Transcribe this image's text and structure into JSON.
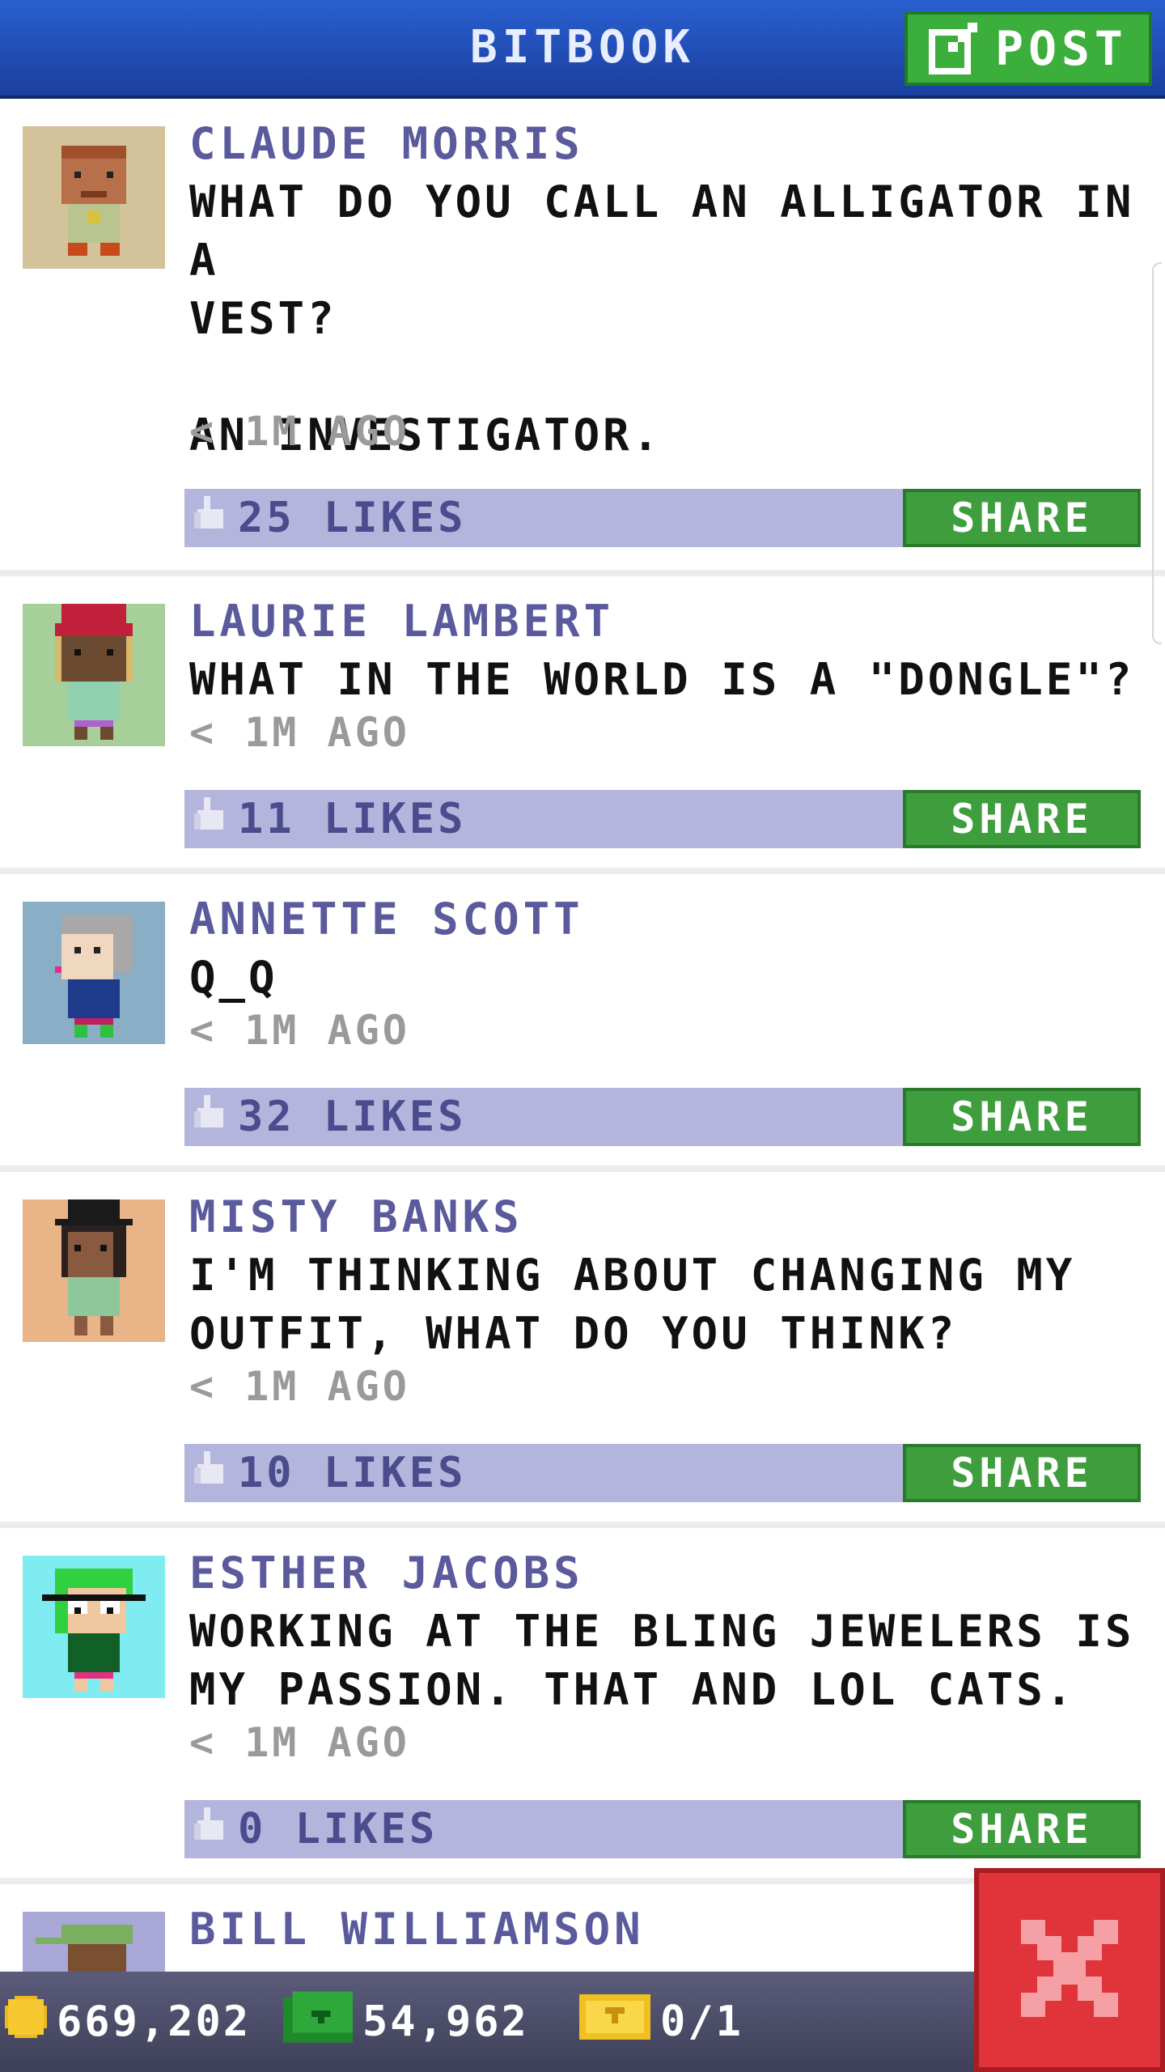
{
  "header": {
    "title": "BITBOOK",
    "post_label": "POST"
  },
  "posts": [
    {
      "name": "CLAUDE MORRIS",
      "message": "WHAT DO YOU CALL AN ALLIGATOR IN A\nVEST?\n\nAN INVESTIGATOR.",
      "time": "< 1M AGO",
      "likes": "25 LIKES",
      "share_label": "SHARE",
      "avatar_bg": "#d4c29a"
    },
    {
      "name": "LAURIE LAMBERT",
      "message": "WHAT IN THE WORLD IS A \"DONGLE\"?",
      "time": "< 1M AGO",
      "likes": "11 LIKES",
      "share_label": "SHARE",
      "avatar_bg": "#a6cf9a"
    },
    {
      "name": "ANNETTE SCOTT",
      "message": "Q_Q",
      "time": "< 1M AGO",
      "likes": "32 LIKES",
      "share_label": "SHARE",
      "avatar_bg": "#8aaec6"
    },
    {
      "name": "MISTY BANKS",
      "message": "I'M THINKING ABOUT CHANGING MY\nOUTFIT, WHAT DO YOU THINK?",
      "time": "< 1M AGO",
      "likes": "10 LIKES",
      "share_label": "SHARE",
      "avatar_bg": "#e8b488"
    },
    {
      "name": "ESTHER JACOBS",
      "message": "WORKING AT THE BLING JEWELERS IS\nMY PASSION. THAT AND LOL CATS.",
      "time": "< 1M AGO",
      "likes": "0 LIKES",
      "share_label": "SHARE",
      "avatar_bg": "#7eecf0"
    },
    {
      "name": "BILL WILLIAMSON",
      "avatar_bg": "#a9a6d8"
    }
  ],
  "footer": {
    "coins": "669,202",
    "bux": "54,962",
    "tickets": "0/1"
  },
  "colors": {
    "header_blue": "#2a5fd0",
    "button_green": "#3cae3c",
    "like_bar": "#b3b5dc",
    "name_purple": "#5a5a9c",
    "close_red": "#e0333a"
  },
  "icons": [
    "edit-icon",
    "thumbs-up-icon",
    "coin-icon",
    "bux-icon",
    "ticket-icon",
    "close-icon"
  ]
}
